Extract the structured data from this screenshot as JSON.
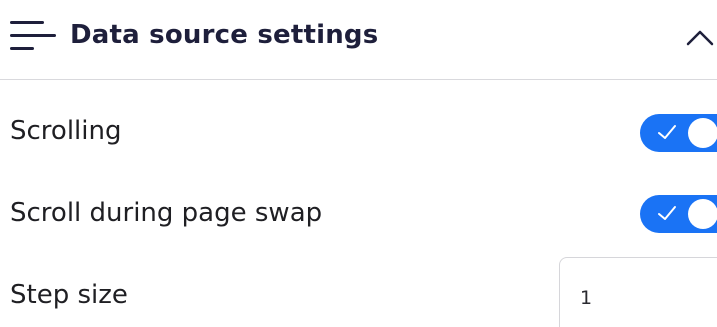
{
  "header": {
    "title": "Data source settings",
    "menu_icon": "hamburger-menu-icon",
    "collapse_icon": "chevron-up-icon"
  },
  "settings": {
    "scrolling": {
      "label": "Scrolling",
      "enabled": true
    },
    "scroll_during_page_swap": {
      "label": "Scroll during page swap",
      "enabled": true
    },
    "step_size": {
      "label": "Step size",
      "value": "1"
    }
  },
  "colors": {
    "accent": "#1a73f5",
    "title_text": "#1e1f3b",
    "divider": "#d9d9dd"
  }
}
